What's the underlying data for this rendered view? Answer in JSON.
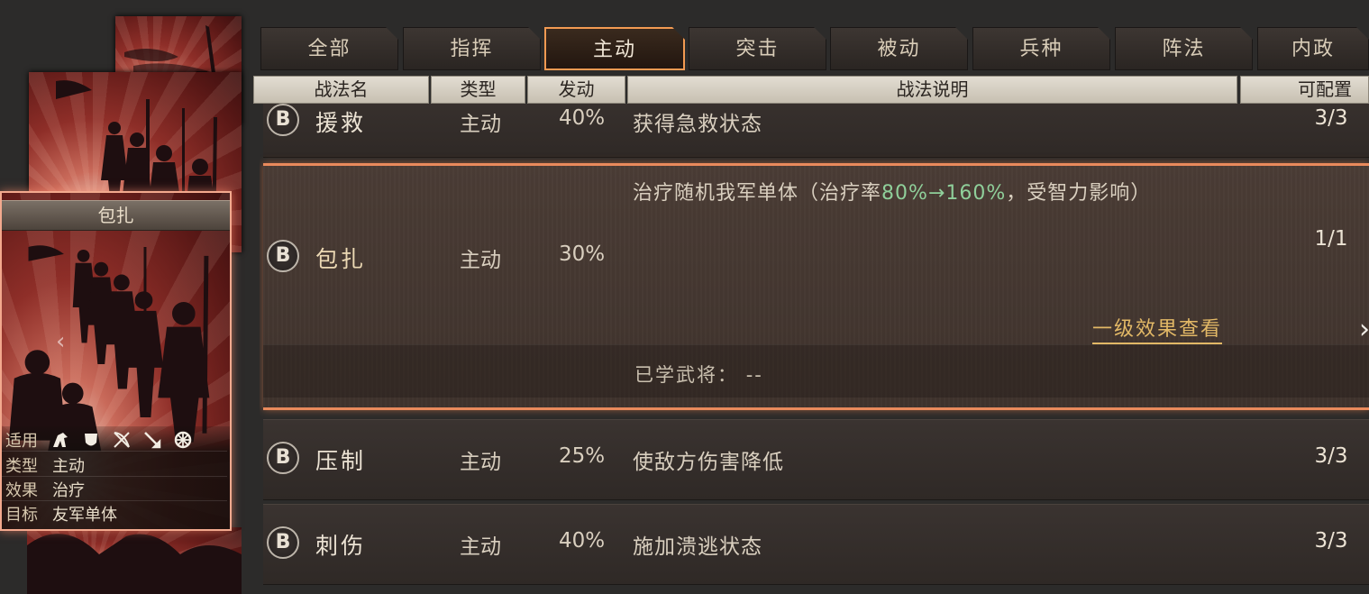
{
  "tabs": [
    {
      "label": "全部",
      "active": false
    },
    {
      "label": "指挥",
      "active": false
    },
    {
      "label": "主动",
      "active": true
    },
    {
      "label": "突击",
      "active": false
    },
    {
      "label": "被动",
      "active": false
    },
    {
      "label": "兵种",
      "active": false
    },
    {
      "label": "阵法",
      "active": false
    },
    {
      "label": "内政",
      "active": false
    }
  ],
  "columns": {
    "name": "战法名",
    "type": "类型",
    "rate": "发动",
    "desc": "战法说明",
    "config": "可配置"
  },
  "rows": [
    {
      "grade": "B",
      "name": "援救",
      "type": "主动",
      "rate": "40%",
      "desc": "获得急救状态",
      "config": "3/3"
    },
    {
      "grade": "B",
      "name": "包扎",
      "type": "主动",
      "rate": "30%",
      "desc_prefix": "治疗随机我军单体（治疗率",
      "desc_highlight": "80%→160%",
      "desc_suffix": "，受智力影响）",
      "config": "1/1",
      "detail_link": "一级效果查看",
      "learned_label": "已学武将：",
      "learned_value": "--"
    },
    {
      "grade": "B",
      "name": "压制",
      "type": "主动",
      "rate": "25%",
      "desc": "使敌方伤害降低",
      "config": "3/3"
    },
    {
      "grade": "B",
      "name": "刺伤",
      "type": "主动",
      "rate": "40%",
      "desc": "施加溃逃状态",
      "config": "3/3"
    }
  ],
  "card": {
    "title": "包扎",
    "info": [
      {
        "key": "适用",
        "value": ""
      },
      {
        "key": "类型",
        "value": "主动"
      },
      {
        "key": "效果",
        "value": "治疗"
      },
      {
        "key": "目标",
        "value": "友军单体"
      }
    ],
    "troop_icons": [
      "cavalry-icon",
      "shield-icon",
      "bow-icon",
      "spear-icon",
      "wheel-icon"
    ]
  },
  "accent_color": "#f29a52",
  "highlight_color": "#8fcf9a"
}
